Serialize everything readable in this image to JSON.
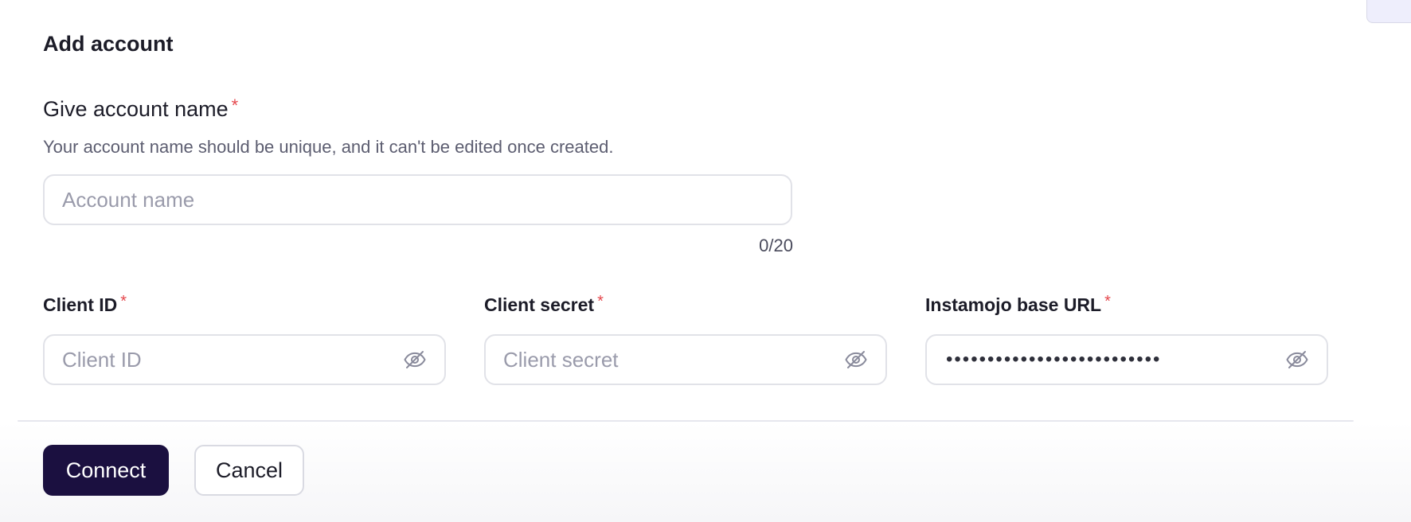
{
  "form": {
    "title": "Add account",
    "account_name": {
      "label": "Give account name",
      "required_mark": "*",
      "helper": "Your account name should be unique, and it can't be edited once created.",
      "placeholder": "Account name",
      "value": "",
      "counter": "0/20"
    },
    "fields": [
      {
        "label": "Client ID",
        "required_mark": "*",
        "placeholder": "Client ID",
        "value": ""
      },
      {
        "label": "Client secret",
        "required_mark": "*",
        "placeholder": "Client secret",
        "value": ""
      },
      {
        "label": "Instamojo base URL",
        "required_mark": "*",
        "placeholder": "",
        "value": "••••••••••••••••••••••••••"
      }
    ],
    "visibility_icon": "eye-off-icon"
  },
  "actions": {
    "connect_label": "Connect",
    "cancel_label": "Cancel"
  },
  "colors": {
    "primary_button": "#1b1040",
    "required": "#e5484d",
    "border": "#e1e2e8",
    "placeholder": "#9a9bab",
    "helper_text": "#5c5d70"
  }
}
